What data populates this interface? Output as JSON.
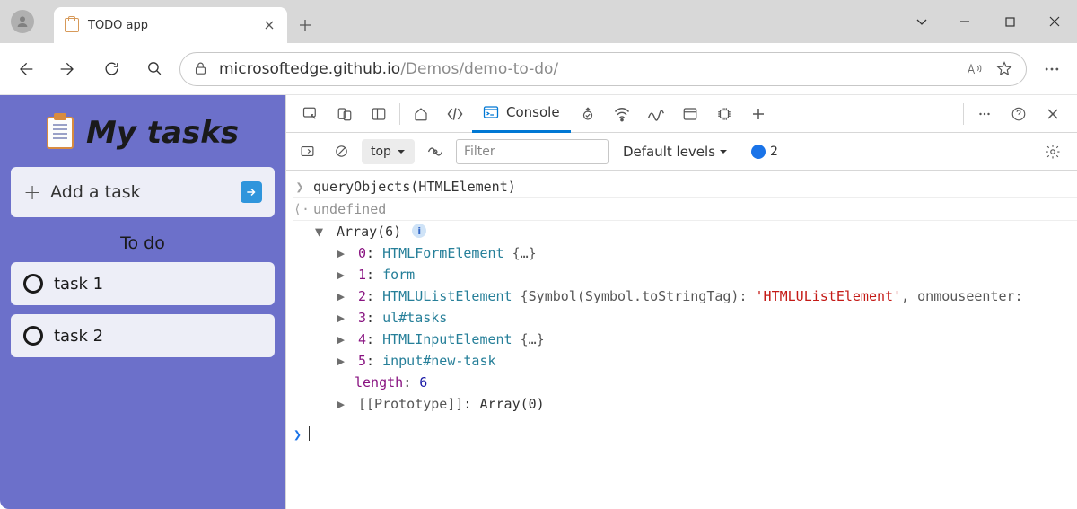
{
  "browser": {
    "tab_title": "TODO app",
    "url_host": "microsoftedge.github.io",
    "url_path": "/Demos/demo-to-do/"
  },
  "page": {
    "heading": "My tasks",
    "add_placeholder": "Add a task",
    "section_header": "To do",
    "tasks": [
      "task 1",
      "task 2"
    ]
  },
  "devtools": {
    "active_tab": "Console",
    "context": "top",
    "filter_placeholder": "Filter",
    "levels": "Default levels",
    "issue_count": "2"
  },
  "console": {
    "input": "queryObjects(HTMLElement)",
    "return_immediate": "undefined",
    "array_label": "Array(6)",
    "entries": [
      {
        "idx": "0",
        "text": "HTMLFormElement ",
        "suffix": "{…}"
      },
      {
        "idx": "1",
        "text": "form",
        "suffix": ""
      },
      {
        "idx": "2",
        "text": "HTMLUListElement ",
        "suffix": "{Symbol(Symbol.toStringTag): ",
        "str": "'HTMLUListElement'",
        "tail": ", onmouseenter:"
      },
      {
        "idx": "3",
        "text": "ul#tasks",
        "suffix": ""
      },
      {
        "idx": "4",
        "text": "HTMLInputElement ",
        "suffix": "{…}"
      },
      {
        "idx": "5",
        "text": "input#new-task",
        "suffix": ""
      }
    ],
    "length_key": "length",
    "length_val": "6",
    "proto_key": "[[Prototype]]",
    "proto_val": "Array(0)"
  }
}
